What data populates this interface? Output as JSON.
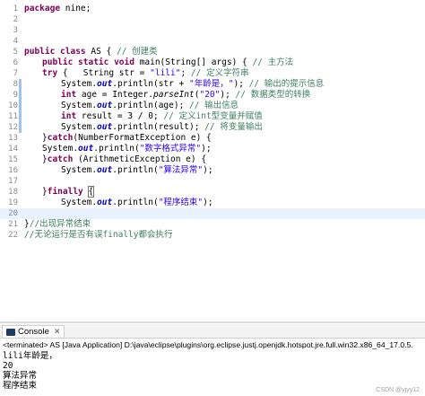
{
  "editor": {
    "lines": [
      {
        "n": "1",
        "t": [
          {
            "c": "kw",
            "v": "package"
          },
          {
            "c": "",
            "v": " nine;"
          }
        ]
      },
      {
        "n": "2",
        "t": []
      },
      {
        "n": "3",
        "t": []
      },
      {
        "n": "4",
        "t": []
      },
      {
        "n": "5",
        "t": [
          {
            "c": "kw",
            "v": "public class"
          },
          {
            "c": "",
            "v": " AS { "
          },
          {
            "c": "cmt",
            "v": "// 创建类"
          }
        ]
      },
      {
        "n": "6",
        "t": [
          {
            "c": "kw",
            "v": "public static void"
          },
          {
            "c": "",
            "v": " main(String[] args) { "
          },
          {
            "c": "cmt",
            "v": "// 主方法"
          }
        ]
      },
      {
        "n": "7",
        "t": [
          {
            "c": "kw",
            "v": "try"
          },
          {
            "c": "",
            "v": " {   String str = "
          },
          {
            "c": "str",
            "v": "\"lili\""
          },
          {
            "c": "",
            "v": "; "
          },
          {
            "c": "cmt",
            "v": "// 定义字符串"
          }
        ]
      },
      {
        "n": "8",
        "t": [
          {
            "c": "",
            "v": "System."
          },
          {
            "c": "fld",
            "v": "out"
          },
          {
            "c": "",
            "v": ".println(str + "
          },
          {
            "c": "str",
            "v": "\"年龄是，\""
          },
          {
            "c": "",
            "v": "); "
          },
          {
            "c": "cmt",
            "v": "// 输出的提示信息"
          }
        ]
      },
      {
        "n": "9",
        "t": [
          {
            "c": "kw",
            "v": "int"
          },
          {
            "c": "",
            "v": " age = Integer."
          },
          {
            "c": "mth",
            "v": "parseInt"
          },
          {
            "c": "",
            "v": "("
          },
          {
            "c": "str",
            "v": "\"20\""
          },
          {
            "c": "",
            "v": "); "
          },
          {
            "c": "cmt",
            "v": "// 数据类型的转换"
          }
        ]
      },
      {
        "n": "10",
        "t": [
          {
            "c": "",
            "v": "System."
          },
          {
            "c": "fld",
            "v": "out"
          },
          {
            "c": "",
            "v": ".println(age); "
          },
          {
            "c": "cmt",
            "v": "// 输出信息"
          }
        ]
      },
      {
        "n": "11",
        "t": [
          {
            "c": "kw",
            "v": "int"
          },
          {
            "c": "",
            "v": " result = 3 / 0; "
          },
          {
            "c": "cmt",
            "v": "// 定义int型变量并赋值"
          }
        ]
      },
      {
        "n": "12",
        "t": [
          {
            "c": "",
            "v": "System."
          },
          {
            "c": "fld",
            "v": "out"
          },
          {
            "c": "",
            "v": ".println(result); "
          },
          {
            "c": "cmt",
            "v": "// 将变量输出"
          }
        ]
      },
      {
        "n": "13",
        "t": [
          {
            "c": "",
            "v": "}"
          },
          {
            "c": "kw",
            "v": "catch"
          },
          {
            "c": "",
            "v": "(NumberFormatException e) {"
          }
        ]
      },
      {
        "n": "14",
        "t": [
          {
            "c": "",
            "v": "System."
          },
          {
            "c": "fld",
            "v": "out"
          },
          {
            "c": "",
            "v": ".println("
          },
          {
            "c": "str",
            "v": "\"数字格式异常\""
          },
          {
            "c": "",
            "v": ");"
          }
        ]
      },
      {
        "n": "15",
        "t": [
          {
            "c": "",
            "v": "}"
          },
          {
            "c": "kw",
            "v": "catch"
          },
          {
            "c": "",
            "v": " (ArithmeticException e) {"
          }
        ]
      },
      {
        "n": "16",
        "t": [
          {
            "c": "",
            "v": "System."
          },
          {
            "c": "fld",
            "v": "out"
          },
          {
            "c": "",
            "v": ".println("
          },
          {
            "c": "str",
            "v": "\"算法异常\""
          },
          {
            "c": "",
            "v": ");"
          }
        ]
      },
      {
        "n": "17",
        "t": []
      },
      {
        "n": "18",
        "t": [
          {
            "c": "",
            "v": "}"
          },
          {
            "c": "kw",
            "v": "finally"
          },
          {
            "c": "",
            "v": " "
          },
          {
            "c": "curbox",
            "v": "{"
          }
        ]
      },
      {
        "n": "19",
        "t": [
          {
            "c": "",
            "v": "System."
          },
          {
            "c": "fld",
            "v": "out"
          },
          {
            "c": "",
            "v": ".println("
          },
          {
            "c": "str",
            "v": "\"程序结束\""
          },
          {
            "c": "",
            "v": ");"
          }
        ]
      },
      {
        "n": "20",
        "t": []
      },
      {
        "n": "21",
        "t": [
          {
            "c": "",
            "v": "}"
          },
          {
            "c": "cmt",
            "v": "//出现异常结束"
          }
        ]
      },
      {
        "n": "22",
        "t": [
          {
            "c": "cmt",
            "v": "//无论运行是否有误finally都会执行"
          }
        ]
      }
    ]
  },
  "console": {
    "tab_label": "Console",
    "terminated_line": "<terminated> AS [Java Application] D:\\java\\eclipse\\plugins\\org.eclipse.justj.openjdk.hotspot.jre.full.win32.x86_64_17.0.5.",
    "output_lines": [
      "lili年龄是，",
      "20",
      "算法异常",
      "程序结束"
    ]
  },
  "watermark": "CSDN @yjyy12"
}
